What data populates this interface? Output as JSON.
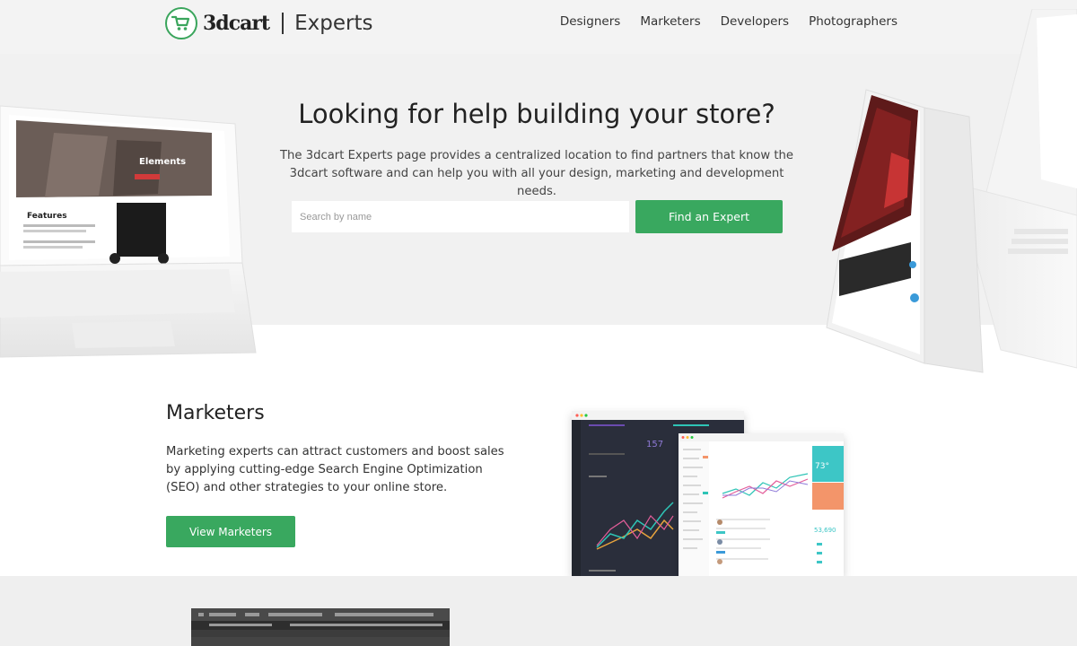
{
  "header": {
    "logo_word": "3dcart",
    "logo_suffix": "Experts",
    "nav": [
      "Designers",
      "Marketers",
      "Developers",
      "Photographers"
    ]
  },
  "hero": {
    "title": "Looking for help building your store?",
    "description": "The 3dcart Experts page provides a centralized location to find partners that know the 3dcart software and can help you with all your design, marketing and development needs.",
    "search_placeholder": "Search by name",
    "cta_label": "Find an Expert",
    "left_mockup": {
      "banner_text": "Elements",
      "features_heading": "Features"
    }
  },
  "marketers": {
    "title": "Marketers",
    "description": "Marketing experts can attract customers and boost sales by applying cutting-edge Search Engine Optimization (SEO) and other strategies to your online store.",
    "cta_label": "View Marketers",
    "dashboard": {
      "stat_value": "157",
      "temperature": "73°",
      "amount": "53,690"
    }
  },
  "colors": {
    "accent": "#39a85f",
    "hero_bg": "#f1f1f1",
    "dark_panel": "#2b2f3a"
  },
  "icons": {
    "logo": "shopping-cart-icon"
  }
}
